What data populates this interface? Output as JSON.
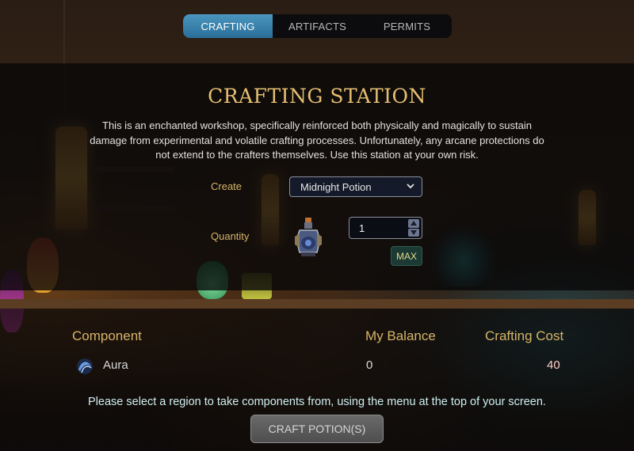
{
  "tabs": [
    {
      "label": "CRAFTING",
      "active": true
    },
    {
      "label": "ARTIFACTS",
      "active": false
    },
    {
      "label": "PERMITS",
      "active": false
    }
  ],
  "station": {
    "title": "CRAFTING STATION",
    "description": "This is an enchanted workshop, specifically reinforced both physically and magically to sustain damage from experimental and volatile crafting processes. Unfortunately, any arcane protections do not extend to the crafters themselves. Use this station at your own risk."
  },
  "form": {
    "create_label": "Create",
    "create_value": "Midnight Potion",
    "quantity_label": "Quantity",
    "quantity_value": "1",
    "max_label": "MAX",
    "item_icon": "potion-icon"
  },
  "components": {
    "headers": {
      "component": "Component",
      "balance": "My Balance",
      "cost": "Crafting Cost"
    },
    "rows": [
      {
        "name": "Aura",
        "icon": "aura-icon",
        "balance": "0",
        "cost": "40"
      }
    ]
  },
  "notice": "Please select a region to take components from, using the menu at the top of your screen.",
  "craft_button_label": "CRAFT POTION(S)",
  "colors": {
    "accent_gold": "#e6bf73",
    "tab_active": "#3a84b0",
    "cost_warning": "#ffd0c8",
    "max_button": "#1a3a33"
  }
}
